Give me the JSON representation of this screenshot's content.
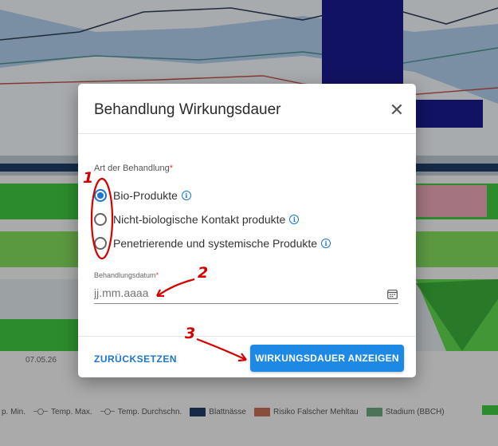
{
  "background": {
    "date_label": "07.05.26",
    "legend": [
      {
        "kind": "marker",
        "label": "p. Min."
      },
      {
        "kind": "marker",
        "label": "Temp. Max."
      },
      {
        "kind": "marker",
        "label": "Temp. Durchschn."
      },
      {
        "kind": "swatch",
        "label": "Blattnässe",
        "color": "#1f3b63"
      },
      {
        "kind": "swatch",
        "label": "Risiko Falscher Mehltau",
        "color": "#c06a55"
      },
      {
        "kind": "swatch",
        "label": "Stadium (BBCH)",
        "color": "#6aa07a"
      }
    ]
  },
  "dialog": {
    "title": "Behandlung Wirkungsdauer",
    "close_icon": "close-icon",
    "treatment_type": {
      "label": "Art der Behandlung",
      "required_mark": "*",
      "options": [
        {
          "label": "Bio-Produkte",
          "selected": true
        },
        {
          "label": "Nicht-biologische Kontakt produkte",
          "selected": false
        },
        {
          "label": "Penetrierende und systemische Produkte",
          "selected": false
        }
      ]
    },
    "date_field": {
      "label": "Behandlungsdatum",
      "required_mark": "*",
      "placeholder": "jj.mm.aaaa",
      "value": ""
    },
    "buttons": {
      "reset": "ZURÜCKSETZEN",
      "show": "WIRKUNGSDAUER ANZEIGEN"
    }
  },
  "annotations": [
    "1",
    "2",
    "3"
  ],
  "colors": {
    "accent": "#1976d2",
    "annotation": "#d50000"
  }
}
